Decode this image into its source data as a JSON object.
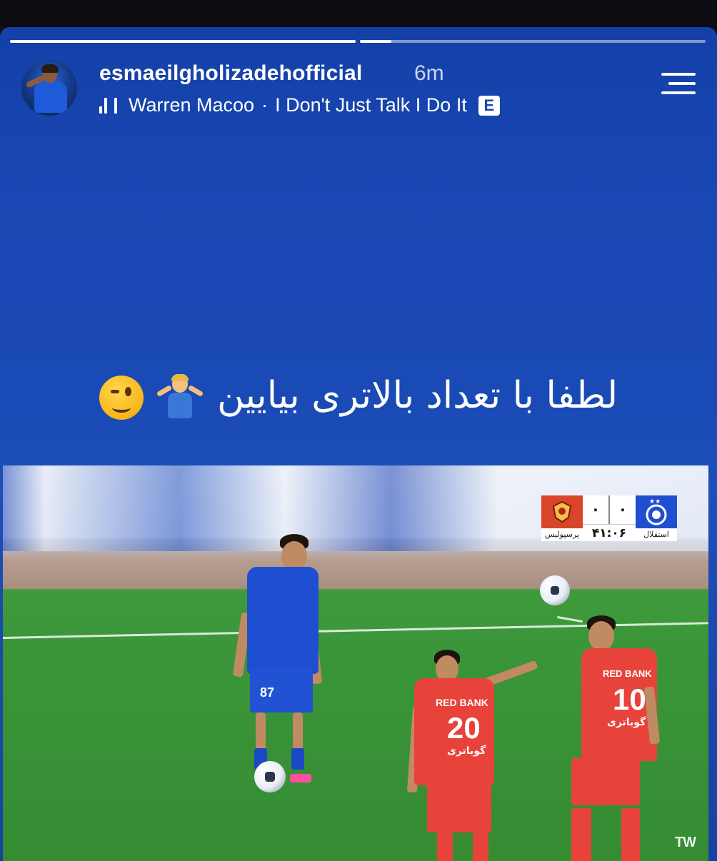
{
  "story": {
    "progress": [
      1.0,
      0.1
    ],
    "username": "esmaeilgholizadehofficial",
    "time_ago": "6m",
    "music": {
      "artist": "Warren Macoo",
      "separator": "·",
      "song": "I Don't Just Talk I Do It",
      "explicit_badge": "E"
    },
    "caption": "لطفا با تعداد بالاتری بیایین",
    "caption_emojis": [
      "shrug-emoji",
      "wink-emoji"
    ]
  },
  "video": {
    "scoreboard": {
      "home_team": "استقلال",
      "away_team": "پرسپولیس",
      "home_score": "۰",
      "away_score": "۰",
      "clock": "۴۱:۰۶"
    },
    "players": [
      {
        "number": "87",
        "sponsor": "",
        "team": "blue"
      },
      {
        "number": "20",
        "sponsor": "RED BANK",
        "name": "گوباتری",
        "team": "red"
      },
      {
        "number": "10",
        "sponsor": "RED BANK",
        "name": "گوباتری",
        "team": "red"
      }
    ],
    "watermark": "TW"
  },
  "colors": {
    "story_bg": "#1a4ab5",
    "blue_kit": "#1f4fd0",
    "red_kit": "#e8433a",
    "pitch": "#3a9538"
  }
}
